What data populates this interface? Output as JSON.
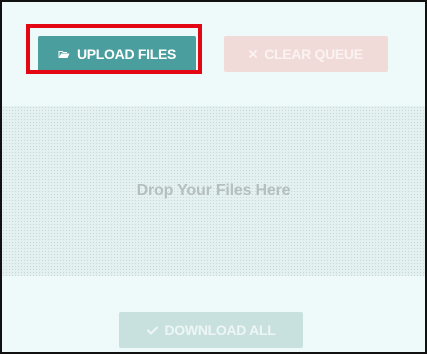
{
  "toolbar": {
    "upload_label": "UPLOAD FILES",
    "upload_icon": "folder-open-icon",
    "clear_label": "CLEAR QUEUE",
    "clear_icon": "close-icon"
  },
  "dropzone": {
    "label": "Drop Your Files Here"
  },
  "footer": {
    "download_label": "DOWNLOAD ALL",
    "download_icon": "checkmark-icon"
  },
  "colors": {
    "upload_button": "#4a9f9e",
    "clear_button": "#f1dbd8",
    "download_button": "#c9e1de",
    "highlight": "#e30613",
    "panel_background": "#eef9f9"
  }
}
